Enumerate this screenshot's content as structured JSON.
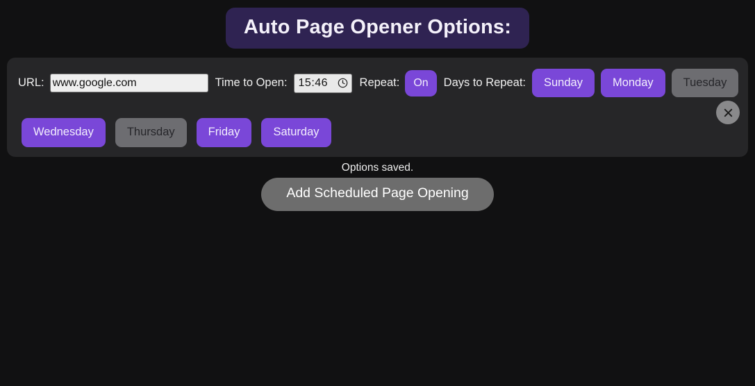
{
  "header": {
    "title": "Auto Page Opener Options:",
    "background_color": "#2f2352"
  },
  "options_panel": {
    "url": {
      "label": "URL:",
      "value": "www.google.com",
      "placeholder": "www.google.com"
    },
    "time_to_open": {
      "label": "Time to Open:",
      "value": "15:46",
      "icon": "clock-icon"
    },
    "repeat": {
      "label": "Repeat:",
      "toggle_value": "On",
      "state": "on"
    },
    "days_to_repeat": {
      "label": "Days to Repeat:",
      "days": [
        {
          "name": "Sunday",
          "active": true
        },
        {
          "name": "Monday",
          "active": true
        },
        {
          "name": "Tuesday",
          "active": false
        },
        {
          "name": "Wednesday",
          "active": true
        },
        {
          "name": "Thursday",
          "active": false
        },
        {
          "name": "Friday",
          "active": true
        },
        {
          "name": "Saturday",
          "active": true
        }
      ]
    },
    "close_button": {
      "icon": "close-icon",
      "label": "×"
    }
  },
  "footer": {
    "status_message": "Options saved.",
    "add_button_label": "Add Scheduled Page Opening"
  },
  "colors": {
    "accent_purple": "#7a47d8",
    "inactive_gray": "#6d6d71",
    "panel_background": "#262628",
    "page_background": "#111112",
    "button_gray": "#6d6d6d"
  }
}
